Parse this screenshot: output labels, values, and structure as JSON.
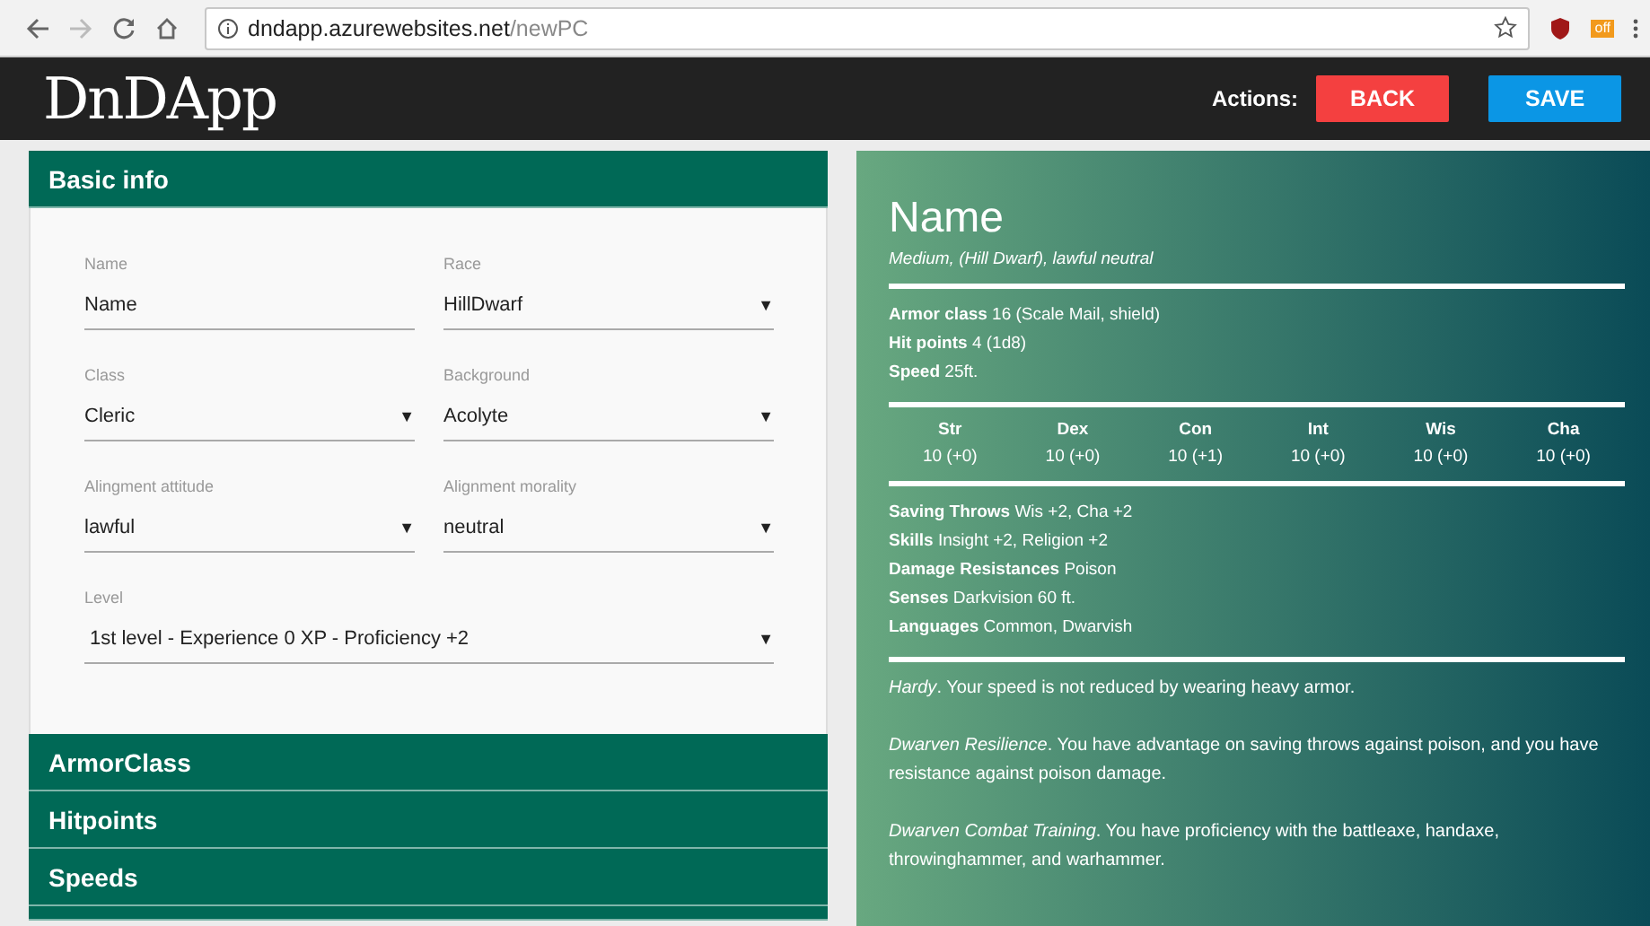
{
  "browser": {
    "url_host": "dndapp.azurewebsites.net",
    "url_path": "/newPC",
    "extension_badge": "off"
  },
  "header": {
    "logo": "DnDApp",
    "actions_label": "Actions:",
    "buttons": [
      {
        "label": "BACK",
        "kind": "back"
      },
      {
        "label": "SAVE",
        "kind": "save"
      }
    ]
  },
  "basic_info": {
    "title": "Basic info",
    "fields": [
      {
        "label": "Name",
        "value": "Name",
        "kind": "text"
      },
      {
        "label": "Race",
        "value": "HillDwarf",
        "kind": "select"
      },
      {
        "label": "Class",
        "value": "Cleric",
        "kind": "select"
      },
      {
        "label": "Background",
        "value": "Acolyte",
        "kind": "select"
      },
      {
        "label": "Alingment attitude",
        "value": "lawful",
        "kind": "select"
      },
      {
        "label": "Alignment morality",
        "value": "neutral",
        "kind": "select"
      },
      {
        "label": "Level",
        "value": "1st level - Experience 0 XP - Proficiency +2",
        "kind": "select-wide"
      }
    ],
    "caret": "▼"
  },
  "sections": [
    "ArmorClass",
    "Hitpoints",
    "Speeds"
  ],
  "stat_block": {
    "name": "Name",
    "subtitle": "Medium, (Hill Dwarf), lawful neutral",
    "basics": [
      "**Armor class** 16 (Scale Mail, shield)",
      "**Hit points** 4 (1d8)",
      "**Speed** 25ft."
    ],
    "abilities": [
      {
        "name": "Str",
        "score": "10 (+0)"
      },
      {
        "name": "Dex",
        "score": "10 (+0)"
      },
      {
        "name": "Con",
        "score": "10 (+1)"
      },
      {
        "name": "Int",
        "score": "10 (+0)"
      },
      {
        "name": "Wis",
        "score": "10 (+0)"
      },
      {
        "name": "Cha",
        "score": "10 (+0)"
      }
    ],
    "details": [
      "**Saving Throws** Wis +2, Cha +2",
      "**Skills** Insight +2, Religion +2",
      "**Damage Resistances** Poison",
      "**Senses** Darkvision 60 ft.",
      "**Languages** Common, Dwarvish"
    ],
    "traits": [
      "*Hardy*. Your speed is not reduced by wearing heavy armor.",
      "*Dwarven Resilience*. You have advantage on saving throws against poison, and you have resistance against poison damage.",
      "*Dwarven Combat Training*. You have proficiency with the battleaxe, handaxe, throwinghammer, and warhammer."
    ]
  }
}
